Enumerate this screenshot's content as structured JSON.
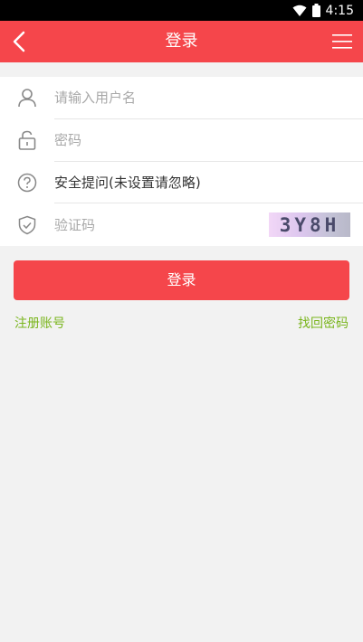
{
  "status_bar": {
    "time": "4:15"
  },
  "header": {
    "title": "登录"
  },
  "form": {
    "username_placeholder": "请输入用户名",
    "password_placeholder": "密码",
    "security_question": "安全提问(未设置请忽略)",
    "captcha_placeholder": "验证码",
    "captcha_code": "3Y8H"
  },
  "actions": {
    "login_label": "登录",
    "register_label": "注册账号",
    "forgot_label": "找回密码"
  },
  "colors": {
    "primary": "#f5464b",
    "link": "#7ab51d",
    "background": "#f2f2f2"
  }
}
